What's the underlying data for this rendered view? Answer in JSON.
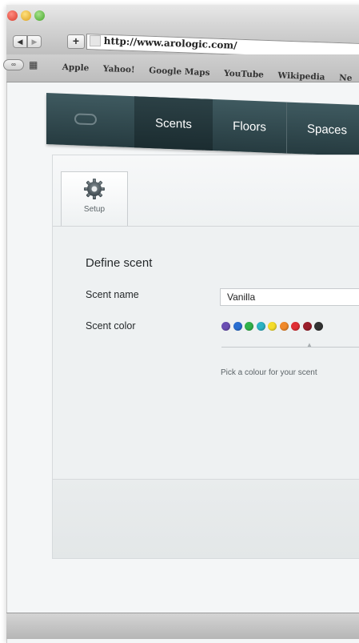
{
  "browser": {
    "url": "http://www.arologic.com/",
    "nav_back_glyph": "◀",
    "nav_forward_glyph": "▶",
    "add_glyph": "+",
    "reader_glyph": "∞",
    "grid_glyph": "▦",
    "bookmarks": [
      "Apple",
      "Yahoo!",
      "Google Maps",
      "YouTube",
      "Wikipedia",
      "Ne"
    ]
  },
  "app_nav": {
    "tabs": [
      "Scents",
      "Floors",
      "Spaces"
    ],
    "active_tab": "Scents"
  },
  "setup_tab": {
    "label": "Setup",
    "icon": "gear-icon"
  },
  "form": {
    "title": "Define scent",
    "scent_name_label": "Scent name",
    "scent_name_value": "Vanilla",
    "scent_color_label": "Scent color",
    "color_hint": "Pick a colour for your scent",
    "colors": [
      "#6b4fb3",
      "#2a6fd1",
      "#31b24a",
      "#2cb3c4",
      "#f5dd2a",
      "#f0892a",
      "#e02f35",
      "#9b1f2b",
      "#333333"
    ]
  }
}
